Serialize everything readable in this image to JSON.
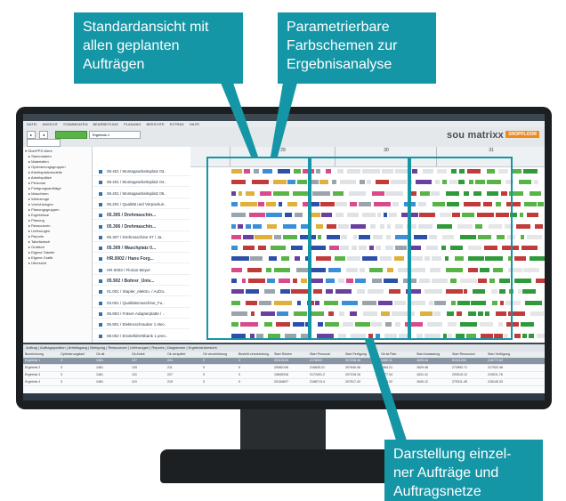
{
  "callouts": {
    "left": [
      "Standardansicht mit",
      "allen geplanten",
      "Aufträgen"
    ],
    "right": [
      "Parametrierbare",
      "Farbschemen zur",
      "Ergebnisanalyse"
    ],
    "bottom": [
      "Darstellung einzel-",
      "ner Aufträge und",
      "Auftragsnetze"
    ]
  },
  "app": {
    "brand": "sou matrixx",
    "brand_badge": "SHOPFLOOR",
    "menu": [
      "DATEI",
      "ANSICHT",
      "STAMMDATEN",
      "BEARBEITUNG",
      "PLANUNG",
      "BERICHTE",
      "EXTRAS",
      "HILFE"
    ],
    "scenario": "Ergebnis 1",
    "tree": [
      "OberPPS-Werk",
      "Stammdaten",
      "Materialien",
      "Optimierungsgruppen",
      "Arbeitsplatzmodelle",
      "Arbeitsplätze",
      "Personal",
      "Fertigungsaufträge",
      "Maschinen",
      "Werkzeuge",
      "Vorrichtungen",
      "Planungsgruppen",
      "Ergebnisse",
      "Planung",
      "Ressourcen",
      "Lieferungen",
      "Reports",
      "Tabellarisch",
      "Grafisch",
      "Eigene Tabelle",
      "Eigene Grafik",
      "Übersicht"
    ],
    "rows": [
      {
        "label": "08.401 / Montagearbeitsplatz 03..",
        "bold": false
      },
      {
        "label": "08.401 / Montagearbeitsplatz 04..",
        "bold": false
      },
      {
        "label": "08.401 / Montagearbeitsplatz 05..",
        "bold": false
      },
      {
        "label": "05.201 / Qualität und Verpackun..",
        "bold": false
      },
      {
        "label": "05.305 / Drehmaschin...",
        "bold": true
      },
      {
        "label": "05.306 / Drehmaschin...",
        "bold": true
      },
      {
        "label": "05.307 / Drehmaschine 07 / Ja..",
        "bold": false
      },
      {
        "label": "05.309 / Waschplatz 0...",
        "bold": true
      },
      {
        "label": "HR.0002 / Hans Forg...",
        "bold": true
      },
      {
        "label": "HR.0003 / Florian Meyer",
        "bold": false
      },
      {
        "label": "05.902 / Bohrer_Univ...",
        "bold": true
      },
      {
        "label": "01.001 / Stapler_elektro. / Aufzü..",
        "bold": false
      },
      {
        "label": "03.001 / Qualitätsmaschine_Fu..",
        "bold": false
      },
      {
        "label": "05.903 / Fräser-Adapterplatte / ..",
        "bold": false
      },
      {
        "label": "05.901 / Elektroschrauber 1 elec..",
        "bold": false
      },
      {
        "label": "08.002 / Einstelldrehtbank 1 pres..",
        "bold": false
      }
    ],
    "weeks": [
      "29",
      "30",
      "31"
    ],
    "grid_tabs": "Auftrag | Auftragsposition | Arbeitsgang | Belegung | Ressourcen | Lieferungen | Reports | Diagramme | Ergebnisübersicht",
    "grid_headers": [
      "Bezeichnung",
      "Optimierungslauf",
      "Ok alt",
      "Ok Anteil",
      "Ok verspätet",
      "Ok verschiebung",
      "Bestellt verschiebung",
      "Start Rüsten",
      "Start Personal",
      "Start Fertigung",
      "Ok ist Plan",
      "Start Auslastung",
      "Start Ressource",
      "Start Verfügung"
    ],
    "grid_rows": [
      [
        "Ergebnis 1",
        "3",
        "1461",
        "127",
        "224",
        "0",
        "0",
        "20119125",
        "2178022",
        "207008.46",
        "1082.11",
        "1625.44",
        "51311204",
        "218772.52"
      ],
      [
        "Ergebnis 2",
        "3",
        "1461",
        "120",
        "211",
        "0",
        "0",
        "20082106",
        "216835.21",
        "207640.46",
        "1064.21",
        "1629.46",
        "272892.71",
        "217922.46"
      ],
      [
        "Ergebnis 3",
        "3",
        "1461",
        "131",
        "227",
        "0",
        "0",
        "19845318",
        "2172401.2",
        "207218.16",
        "1077.34",
        "1631.41",
        "293015.12",
        "219011.78"
      ],
      [
        "Ergebnis 4",
        "3",
        "1461",
        "119",
        "219",
        "0",
        "0",
        "20154627",
        "2168713.4",
        "207517.42",
        "1089.02",
        "1640.12",
        "270311.45",
        "218140.33"
      ]
    ]
  }
}
